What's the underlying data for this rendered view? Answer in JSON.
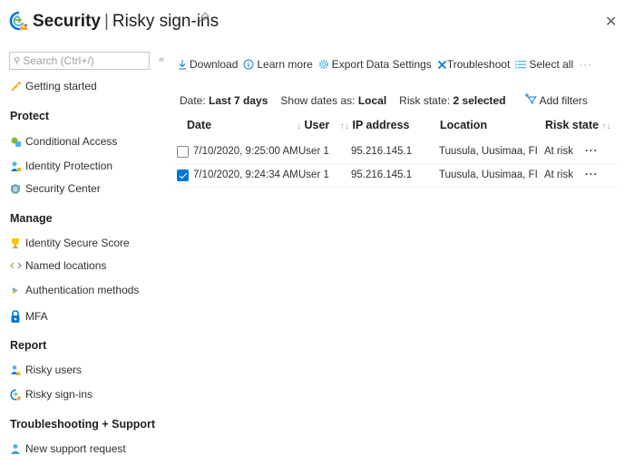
{
  "header": {
    "app_title": "Security",
    "separator": "|",
    "page_title": "Risky sign-ins",
    "pin_icon": "pin-icon",
    "close_icon": "close-icon",
    "close_glyph": "✕"
  },
  "sidebar": {
    "search_placeholder": "Search (Ctrl+/)",
    "collapse_glyph": "«",
    "getting_started": {
      "label": "Getting started",
      "icon": "rocket-icon"
    },
    "sections": [
      {
        "title": "Protect",
        "items": [
          {
            "label": "Conditional Access",
            "icon": "conditional-access-icon"
          },
          {
            "label": "Identity Protection",
            "icon": "identity-protection-icon"
          },
          {
            "label": "Security Center",
            "icon": "shield-icon"
          }
        ]
      },
      {
        "title": "Manage",
        "items": [
          {
            "label": "Identity Secure Score",
            "icon": "trophy-icon"
          },
          {
            "label": "Named locations",
            "icon": "code-brackets-icon"
          },
          {
            "label": "Authentication methods",
            "icon": "key-icon"
          },
          {
            "label": "MFA",
            "icon": "lock-icon"
          }
        ]
      },
      {
        "title": "Report",
        "items": [
          {
            "label": "Risky users",
            "icon": "risky-users-icon"
          },
          {
            "label": "Risky sign-ins",
            "icon": "risky-signins-icon"
          }
        ]
      },
      {
        "title": "Troubleshooting + Support",
        "items": [
          {
            "label": "New support request",
            "icon": "support-person-icon"
          }
        ]
      }
    ]
  },
  "toolbar": {
    "download": "Download",
    "learn_more": "Learn more",
    "export": "Export Data Settings",
    "troubleshoot": "Troubleshoot",
    "select_all": "Select all",
    "more": "···"
  },
  "filters": {
    "date_label": "Date:",
    "date_value": "Last 7 days",
    "show_dates_label": "Show dates as:",
    "show_dates_value": "Local",
    "risk_state_label": "Risk state:",
    "risk_state_value": "2 selected",
    "add_filters": "Add filters"
  },
  "table": {
    "columns": {
      "date": "Date",
      "user_sort": "↓",
      "user": "User",
      "ip_sort": "↑↓",
      "ip": "IP address",
      "location": "Location",
      "risk_state": "Risk state",
      "risk_sort": "↑↓"
    },
    "rows": [
      {
        "checked": false,
        "date": "7/10/2020, 9:25:00 AM",
        "user": "User 1",
        "ip": "95.216.145.1",
        "location": "Tuusula, Uusimaa, FI",
        "risk_state": "At risk",
        "actions": "···"
      },
      {
        "checked": true,
        "date": "7/10/2020, 9:24:34 AM",
        "user": "User 1",
        "ip": "95.216.145.1",
        "location": "Tuusula, Uusimaa, FI",
        "risk_state": "At risk",
        "actions": "···"
      }
    ]
  },
  "colors": {
    "accent": "#0078d4",
    "text": "#323130",
    "muted": "#a19f9d"
  }
}
